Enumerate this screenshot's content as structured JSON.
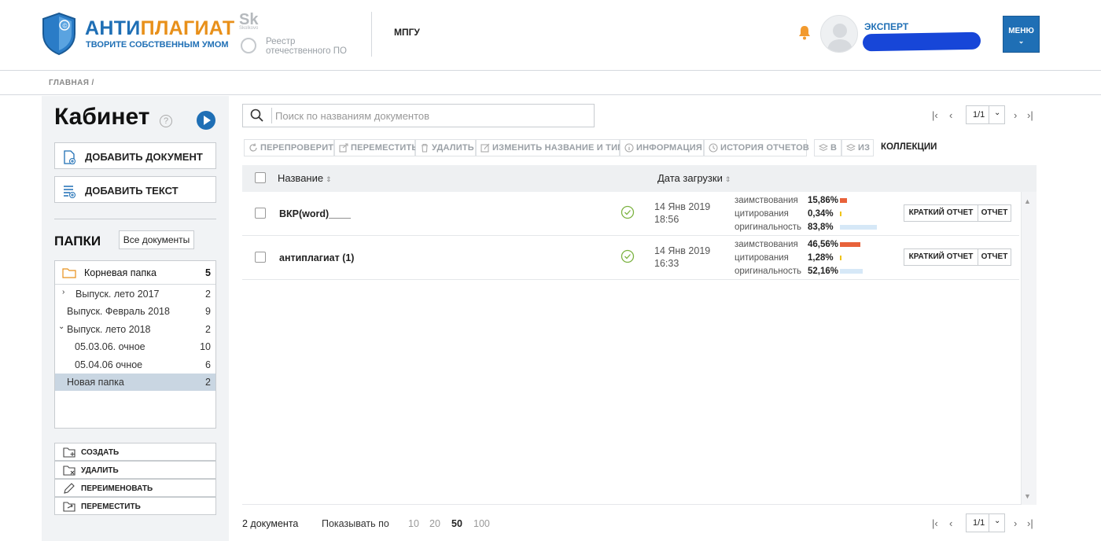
{
  "header": {
    "brand_left": "АНТИ",
    "brand_right": "ПЛАГИАТ",
    "tagline": "ТВОРИТЕ СОБСТВЕННЫМ УМОМ",
    "sk_logo": "Sk",
    "sk_small": "Skolkovo",
    "registry_line1": "Реестр",
    "registry_line2": "отечественного ПО",
    "org": "МПГУ",
    "user_role": "ЭКСПЕРТ",
    "menu_label": "МЕНЮ"
  },
  "breadcrumb": "ГЛАВНАЯ /",
  "sidebar": {
    "title": "Кабинет",
    "help": "?",
    "add_document": "ДОБАВИТЬ ДОКУМЕНТ",
    "add_text": "ДОБАВИТЬ ТЕКСТ",
    "folders_title": "ПАПКИ",
    "all_documents": "Все документы",
    "root_folder": {
      "name": "Корневая папка",
      "count": "5"
    },
    "folders": [
      {
        "name": "Выпуск. лето 2017",
        "count": "2"
      },
      {
        "name": "Выпуск. Февраль 2018",
        "count": "9"
      },
      {
        "name": "Выпуск. лето 2018",
        "count": "2"
      },
      {
        "name": "05.03.06. очное",
        "count": "10"
      },
      {
        "name": "05.04.06 очное",
        "count": "6"
      },
      {
        "name": "Новая папка",
        "count": "2"
      }
    ],
    "actions": {
      "create": "СОЗДАТЬ",
      "delete": "УДАЛИТЬ",
      "rename": "ПЕРЕИМЕНОВАТЬ",
      "move": "ПЕРЕМЕСТИТЬ"
    }
  },
  "search": {
    "placeholder": "Поиск по названиям документов"
  },
  "pager": {
    "top": "1/1",
    "bottom": "1/1"
  },
  "toolbar": {
    "recheck": "ПЕРЕПРОВЕРИТЬ",
    "move": "ПЕРЕМЕСТИТЬ",
    "delete": "УДАЛИТЬ",
    "rename": "ИЗМЕНИТЬ НАЗВАНИЕ И ТИП",
    "info": "ИНФОРМАЦИЯ",
    "history": "ИСТОРИЯ ОТЧЕТОВ",
    "to": "В",
    "from": "ИЗ",
    "collections": "КОЛЛЕКЦИИ"
  },
  "table": {
    "col_name": "Название",
    "col_date": "Дата загрузки",
    "label_borrow": "заимствования",
    "label_cite": "цитирования",
    "label_orig": "оригинальность",
    "btn_short": "КРАТКИЙ ОТЧЕТ",
    "btn_report": "ОТЧЕТ",
    "rows": [
      {
        "name": "ВКР(word)____",
        "date": "14 Янв 2019",
        "time": "18:56",
        "borrow": "15,86%",
        "cite": "0,34%",
        "orig": "83,8%",
        "borrow_frac": 0.1586,
        "cite_frac": 0.0034,
        "orig_frac": 0.838
      },
      {
        "name": "антиплагиат (1)",
        "date": "14 Янв 2019",
        "time": "16:33",
        "borrow": "46,56%",
        "cite": "1,28%",
        "orig": "52,16%",
        "borrow_frac": 0.4656,
        "cite_frac": 0.0128,
        "orig_frac": 0.5216
      }
    ]
  },
  "footer": {
    "doc_count": "2 документа",
    "show_by": "Показывать по",
    "sizes": [
      "10",
      "20",
      "50",
      "100"
    ],
    "active_size": "50"
  },
  "colors": {
    "brand_blue": "#1f6fb5",
    "brand_orange": "#e8901a",
    "borrow_bar": "#e8623a",
    "cite_bar": "#f0c419",
    "orig_bar": "#d6e8f7"
  }
}
